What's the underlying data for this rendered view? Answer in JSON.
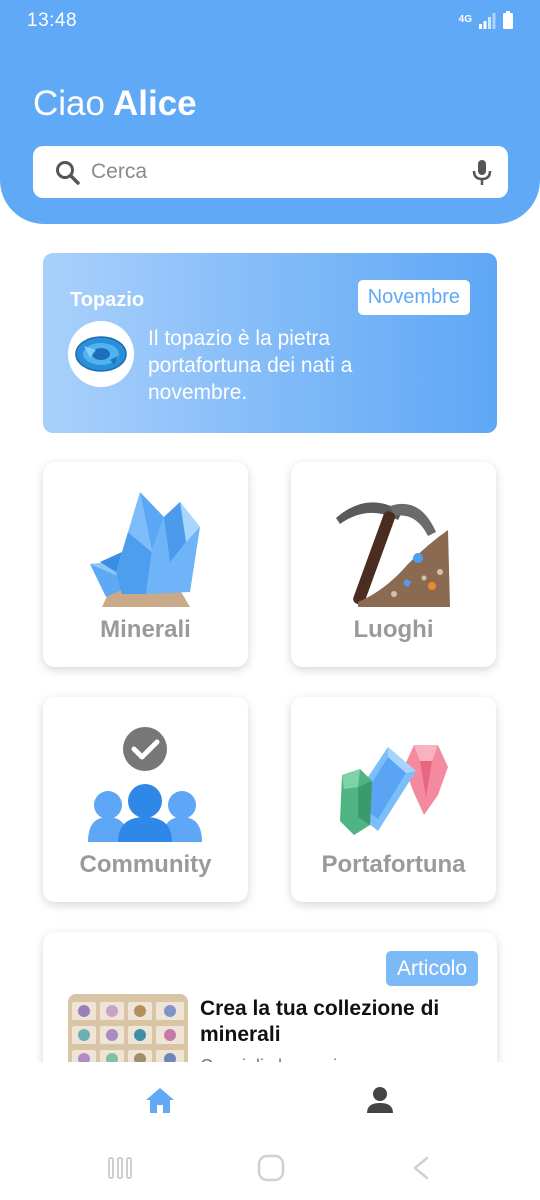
{
  "status_bar": {
    "time": "13:48",
    "network": "4G",
    "icons": [
      "network-4g-icon",
      "signal-icon",
      "battery-icon"
    ]
  },
  "header": {
    "greeting": "Ciao",
    "user_name": "Alice"
  },
  "search": {
    "placeholder": "Cerca",
    "value": ""
  },
  "featured": {
    "title": "Topazio",
    "badge": "Novembre",
    "description": "Il topazio è la pietra portafortuna dei nati a novembre."
  },
  "categories": [
    {
      "label": "Minerali",
      "icon": "crystal-cluster-icon"
    },
    {
      "label": "Luoghi",
      "icon": "pickaxe-mine-icon"
    },
    {
      "label": "Community",
      "icon": "community-group-icon"
    },
    {
      "label": "Portafortuna",
      "icon": "gems-icon"
    }
  ],
  "article": {
    "badge": "Articolo",
    "title": "Crea la tua collezione di minerali",
    "subtitle": "Consigli che ogni..."
  },
  "bottom_nav": {
    "items": [
      "home-icon",
      "profile-icon"
    ],
    "active": "home-icon"
  },
  "colors": {
    "primary": "#5fa9f7",
    "tile_label": "#9a9a9a",
    "white": "#ffffff"
  }
}
